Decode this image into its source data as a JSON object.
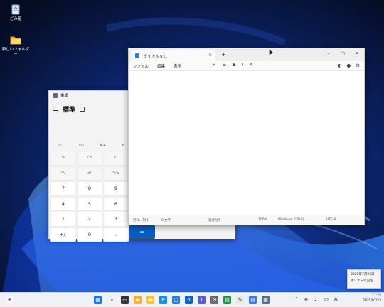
{
  "desktop": {
    "icons": [
      {
        "label": "ごみ箱",
        "icon": "recycle-bin-icon"
      },
      {
        "label": "新しいフォルダー",
        "icon": "folder-icon"
      }
    ]
  },
  "calculator": {
    "window_title": "電卓",
    "mode_title": "標準",
    "memory": [
      "MC",
      "MR",
      "M+",
      "M"
    ],
    "keys": [
      {
        "label": "%",
        "kind": "fn"
      },
      {
        "label": "CE",
        "kind": "fn"
      },
      {
        "label": "C",
        "kind": "fn"
      },
      {
        "label": "¹/ₓ",
        "kind": "fn"
      },
      {
        "label": "x²",
        "kind": "fn"
      },
      {
        "label": "²√x",
        "kind": "fn"
      },
      {
        "label": "7",
        "kind": "num"
      },
      {
        "label": "8",
        "kind": "num"
      },
      {
        "label": "9",
        "kind": "num"
      },
      {
        "label": "4",
        "kind": "num"
      },
      {
        "label": "5",
        "kind": "num"
      },
      {
        "label": "6",
        "kind": "num"
      },
      {
        "label": "1",
        "kind": "num"
      },
      {
        "label": "2",
        "kind": "num"
      },
      {
        "label": "3",
        "kind": "num"
      },
      {
        "label": "+/-",
        "kind": "num"
      },
      {
        "label": "0",
        "kind": "num"
      },
      {
        "label": ".",
        "kind": "num"
      }
    ],
    "equals_label": "="
  },
  "notepad": {
    "tab_title": "タイトルなし",
    "tab_close": "×",
    "new_tab": "+",
    "window_controls": {
      "minimize": "–",
      "maximize": "▢",
      "close": "✕"
    },
    "menu": [
      "ファイル",
      "編集",
      "表示"
    ],
    "format": {
      "heading": "H",
      "list": "☰",
      "bold": "B",
      "italic": "I",
      "clear": "A̶"
    },
    "status": {
      "position": "行 1、列 1",
      "chars": "0 文字",
      "formatting": "書式付き",
      "zoom": "100%",
      "line_ending": "Windows (CRLF)",
      "encoding": "UTF-8"
    }
  },
  "taskbar": {
    "tray": {
      "time": "11:22",
      "date": "2025/07/23"
    }
  },
  "tooltip": {
    "line1": "2025年7月23日",
    "line2": "ホリデーの設定"
  },
  "colors": {
    "accent": "#0a5cc2",
    "taskbar": "#eef1f5"
  }
}
